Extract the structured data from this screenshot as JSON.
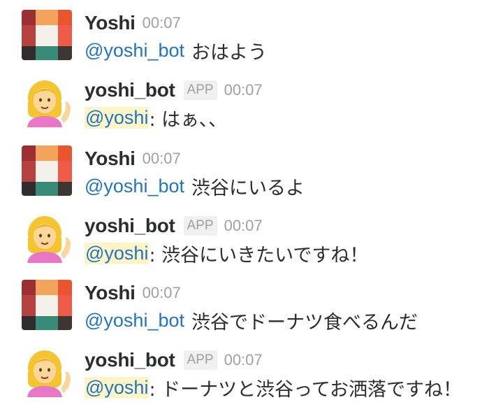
{
  "messages": [
    {
      "user": "Yoshi",
      "is_app": false,
      "time": "00:07",
      "mention": "@yoshi_bot",
      "text": "おはよう"
    },
    {
      "user": "yoshi_bot",
      "is_app": true,
      "badge": "APP",
      "time": "00:07",
      "mention": "@yoshi",
      "text": ": はぁ、、"
    },
    {
      "user": "Yoshi",
      "is_app": false,
      "time": "00:07",
      "mention": "@yoshi_bot",
      "text": "渋谷にいるよ"
    },
    {
      "user": "yoshi_bot",
      "is_app": true,
      "badge": "APP",
      "time": "00:07",
      "mention": "@yoshi",
      "text": ": 渋谷にいきたいですね！"
    },
    {
      "user": "Yoshi",
      "is_app": false,
      "time": "00:07",
      "mention": "@yoshi_bot",
      "text": "渋谷でドーナツ食べるんだ"
    },
    {
      "user": "yoshi_bot",
      "is_app": true,
      "badge": "APP",
      "time": "00:07",
      "mention": "@yoshi",
      "text": ": ドーナツと渋谷ってお洒落ですね！"
    }
  ],
  "colors": {
    "mention": "#1d74c8",
    "mention_highlight": "#fdf5c6",
    "username": "#2c2d30",
    "meta": "#a0a0a2"
  },
  "icons": {
    "user_avatar": "patchwork-grid-avatar",
    "bot_avatar": "woman-tipping-hand-emoji-avatar"
  }
}
